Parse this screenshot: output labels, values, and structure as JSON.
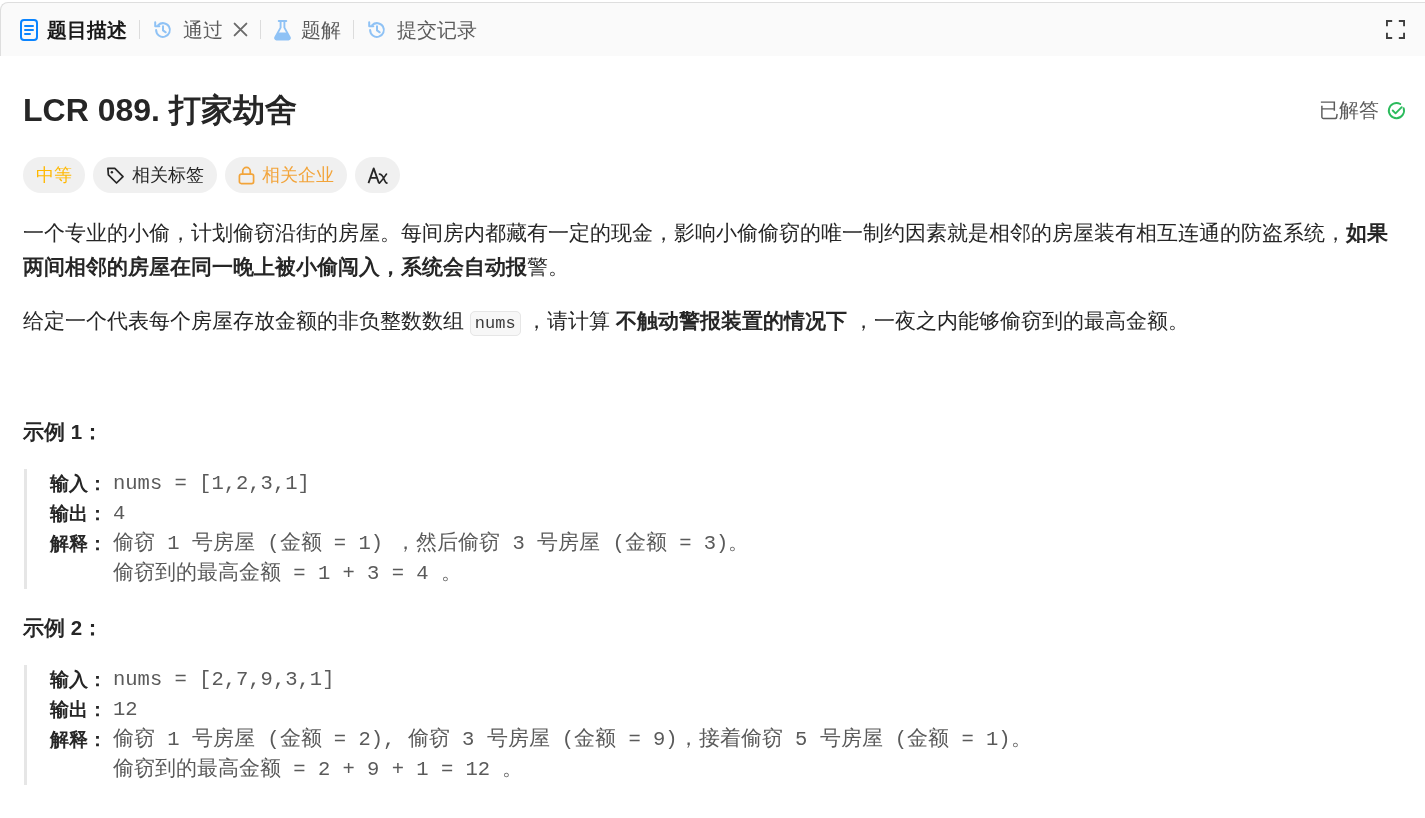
{
  "tabs": [
    {
      "kind": "description",
      "label": "题目描述",
      "selected": true,
      "closable": false
    },
    {
      "kind": "history",
      "label": "通过",
      "selected": false,
      "closable": true
    },
    {
      "kind": "solutions",
      "label": "题解",
      "selected": false,
      "closable": false
    },
    {
      "kind": "history",
      "label": "提交记录",
      "selected": false,
      "closable": false
    }
  ],
  "problem": {
    "title": "LCR 089. 打家劫舍",
    "status": {
      "label": "已解答",
      "solved": true
    }
  },
  "tags": [
    {
      "kind": "difficulty",
      "label": "中等",
      "locked": false
    },
    {
      "kind": "topics",
      "label": "相关标签",
      "locked": false
    },
    {
      "kind": "companies",
      "label": "相关企业",
      "locked": true
    },
    {
      "kind": "translate",
      "locked": false
    }
  ],
  "description": [
    {
      "parts": [
        {
          "kind": "text",
          "text": "一个专业的小偷，计划偷窃沿街的房屋。每间房内都藏有一定的现金，影响小偷偷窃的唯一制约因素就是相邻的房屋装有相互连通的防盗系统，**如果两间相邻的房屋在同一晚上被小偷闯入，系统会自动报**警。"
        }
      ]
    },
    {
      "parts": [
        {
          "kind": "text",
          "text": "给定一个代表每个房屋存放金额的非负整数数组 "
        },
        {
          "kind": "code",
          "text": "nums"
        },
        {
          "kind": "text",
          "text": " ，请计算 **不触动警报装置的情况下** ，一夜之内能够偷窃到的最高金额。"
        }
      ]
    }
  ],
  "examples": [
    {
      "heading": "示例 1：",
      "lines": [
        {
          "label": "输入：",
          "value": "nums = [1,2,3,1]"
        },
        {
          "label": "输出：",
          "value": "4"
        },
        {
          "label": "解释：",
          "value": "偷窃 1 号房屋 (金额 = 1) ，然后偷窃 3 号房屋 (金额 = 3)。"
        },
        {
          "value": "偷窃到的最高金额 = 1 + 3 = 4 。"
        }
      ]
    },
    {
      "heading": "示例 2：",
      "lines": [
        {
          "label": "输入：",
          "value": "nums = [2,7,9,3,1]"
        },
        {
          "label": "输出：",
          "value": "12"
        },
        {
          "label": "解释：",
          "value": "偷窃 1 号房屋 (金额 = 2), 偷窃 3 号房屋 (金额 = 9)，接着偷窃 5 号房屋 (金额 = 1)。"
        },
        {
          "value": "偷窃到的最高金额 = 2 + 9 + 1 = 12 。"
        }
      ]
    }
  ]
}
